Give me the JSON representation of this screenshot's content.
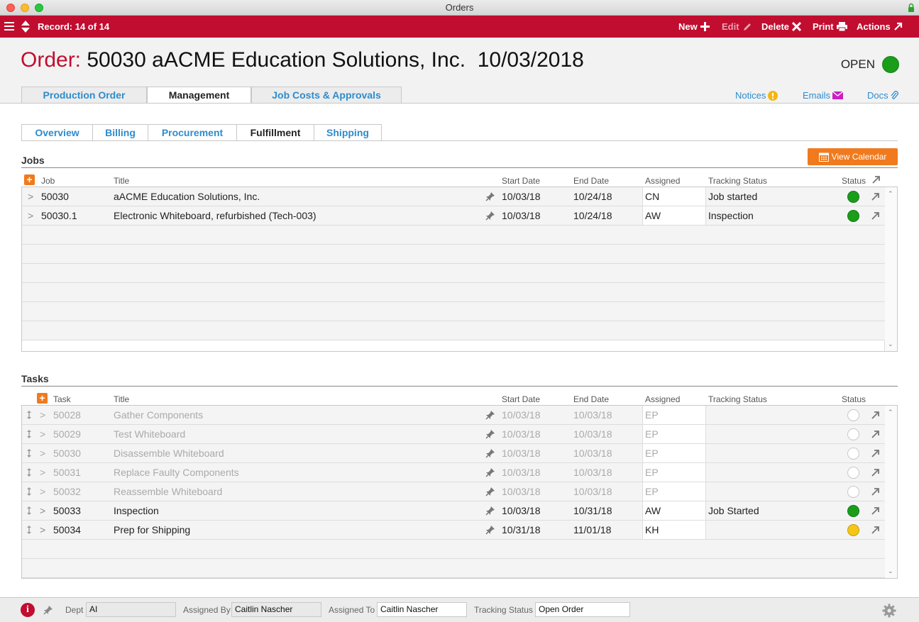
{
  "window": {
    "title": "Orders"
  },
  "toolbar": {
    "record": "Record: 14 of 14",
    "new": "New",
    "edit": "Edit",
    "delete": "Delete",
    "print": "Print",
    "actions": "Actions"
  },
  "order": {
    "label": "Order:",
    "number_customer": "50030 aACME Education Solutions, Inc.",
    "date": "10/03/2018",
    "status": "OPEN",
    "status_color": "#1a9e1a"
  },
  "main_tabs": [
    "Production Order",
    "Management",
    "Job Costs & Approvals"
  ],
  "side_links": {
    "notices": "Notices",
    "emails": "Emails",
    "docs": "Docs"
  },
  "sub_tabs": [
    "Overview",
    "Billing",
    "Procurement",
    "Fulfillment",
    "Shipping"
  ],
  "jobs": {
    "title": "Jobs",
    "view_calendar": "View Calendar",
    "columns": {
      "job": "Job",
      "title": "Title",
      "start": "Start Date",
      "end": "End Date",
      "assigned": "Assigned",
      "tracking": "Tracking Status",
      "status": "Status"
    },
    "rows": [
      {
        "chev": ">",
        "job": "50030",
        "title": "aACME Education Solutions, Inc.",
        "start": "10/03/18",
        "end": "10/24/18",
        "assigned": "CN",
        "tracking": "Job started",
        "status": "green"
      },
      {
        "chev": ">",
        "job": "50030.1",
        "title": "Electronic Whiteboard, refurbished (Tech-003)",
        "start": "10/03/18",
        "end": "10/24/18",
        "assigned": "AW",
        "tracking": "Inspection",
        "status": "green"
      }
    ]
  },
  "tasks": {
    "title": "Tasks",
    "columns": {
      "task": "Task",
      "title": "Title",
      "start": "Start Date",
      "end": "End Date",
      "assigned": "Assigned",
      "tracking": "Tracking Status",
      "status": "Status"
    },
    "rows": [
      {
        "chev": ">",
        "task": "50028",
        "title": "Gather Components",
        "start": "10/03/18",
        "end": "10/03/18",
        "assigned": "EP",
        "tracking": "",
        "status": "empty",
        "dim": true
      },
      {
        "chev": ">",
        "task": "50029",
        "title": "Test Whiteboard",
        "start": "10/03/18",
        "end": "10/03/18",
        "assigned": "EP",
        "tracking": "",
        "status": "empty",
        "dim": true
      },
      {
        "chev": ">",
        "task": "50030",
        "title": "Disassemble Whiteboard",
        "start": "10/03/18",
        "end": "10/03/18",
        "assigned": "EP",
        "tracking": "",
        "status": "empty",
        "dim": true
      },
      {
        "chev": ">",
        "task": "50031",
        "title": "Replace Faulty Components",
        "start": "10/03/18",
        "end": "10/03/18",
        "assigned": "EP",
        "tracking": "",
        "status": "empty",
        "dim": true
      },
      {
        "chev": ">",
        "task": "50032",
        "title": "Reassemble Whiteboard",
        "start": "10/03/18",
        "end": "10/03/18",
        "assigned": "EP",
        "tracking": "",
        "status": "empty",
        "dim": true
      },
      {
        "chev": ">",
        "task": "50033",
        "title": "Inspection",
        "start": "10/03/18",
        "end": "10/31/18",
        "assigned": "AW",
        "tracking": "Job Started",
        "status": "green",
        "dim": false
      },
      {
        "chev": ">",
        "task": "50034",
        "title": "Prep for Shipping",
        "start": "10/31/18",
        "end": "11/01/18",
        "assigned": "KH",
        "tracking": "",
        "status": "yellow",
        "dim": false
      }
    ]
  },
  "footer": {
    "dept_label": "Dept",
    "dept_value": "AI",
    "assigned_by_label": "Assigned By",
    "assigned_by_value": "Caitlin Nascher",
    "assigned_to_label": "Assigned To",
    "assigned_to_value": "Caitlin Nascher",
    "tracking_label": "Tracking Status",
    "tracking_value": "Open Order"
  }
}
